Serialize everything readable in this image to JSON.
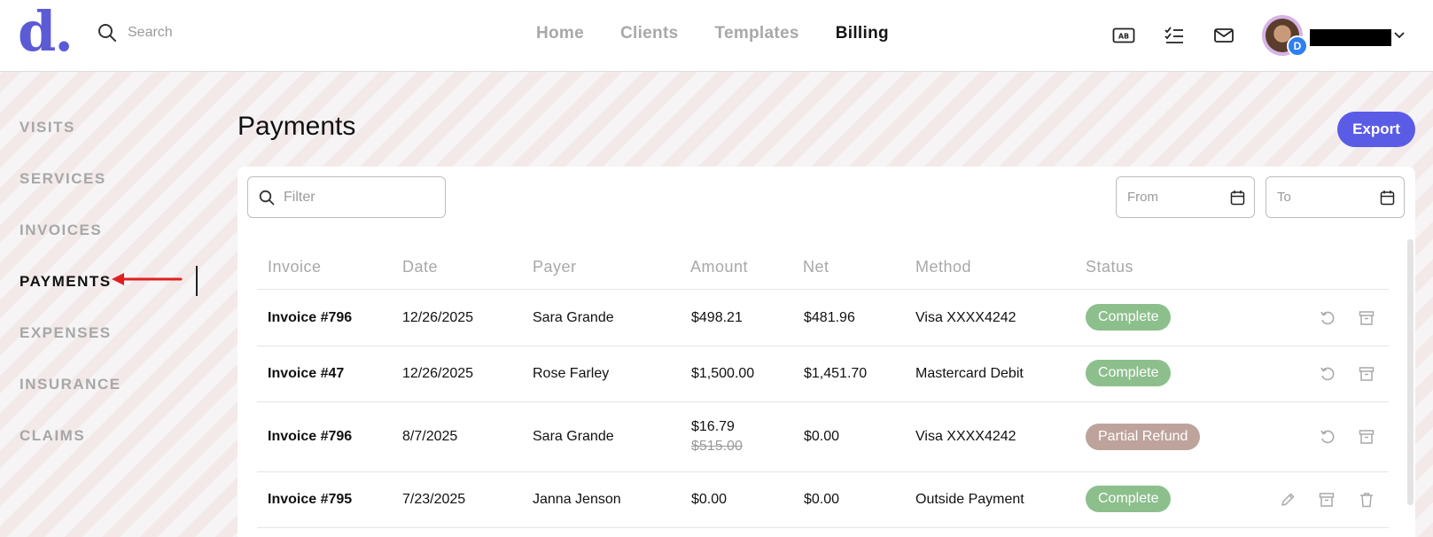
{
  "header": {
    "logo": "d.",
    "search_placeholder": "Search",
    "nav": [
      {
        "label": "Home",
        "active": false
      },
      {
        "label": "Clients",
        "active": false
      },
      {
        "label": "Templates",
        "active": false
      },
      {
        "label": "Billing",
        "active": true
      }
    ],
    "icons": [
      "language-icon",
      "checklist-icon",
      "mail-icon"
    ],
    "avatar_badge": "D"
  },
  "sidebar": {
    "items": [
      {
        "label": "VISITS",
        "active": false
      },
      {
        "label": "SERVICES",
        "active": false
      },
      {
        "label": "INVOICES",
        "active": false
      },
      {
        "label": "PAYMENTS",
        "active": true
      },
      {
        "label": "EXPENSES",
        "active": false
      },
      {
        "label": "INSURANCE",
        "active": false
      },
      {
        "label": "CLAIMS",
        "active": false
      }
    ]
  },
  "main": {
    "title": "Payments",
    "export_label": "Export",
    "filter_placeholder": "Filter",
    "from_placeholder": "From",
    "to_placeholder": "To"
  },
  "table": {
    "columns": [
      "Invoice",
      "Date",
      "Payer",
      "Amount",
      "Net",
      "Method",
      "Status"
    ],
    "rows": [
      {
        "invoice": "Invoice #796",
        "date": "12/26/2025",
        "payer": "Sara Grande",
        "amount": "$498.21",
        "amount_original": "",
        "net": "$481.96",
        "method": "Visa XXXX4242",
        "status": "Complete",
        "actions": [
          "refund-icon",
          "archive-icon"
        ]
      },
      {
        "invoice": "Invoice #47",
        "date": "12/26/2025",
        "payer": "Rose Farley",
        "amount": "$1,500.00",
        "amount_original": "",
        "net": "$1,451.70",
        "method": "Mastercard Debit",
        "status": "Complete",
        "actions": [
          "refund-icon",
          "archive-icon"
        ]
      },
      {
        "invoice": "Invoice #796",
        "date": "8/7/2025",
        "payer": "Sara Grande",
        "amount": "$16.79",
        "amount_original": "$515.00",
        "net": "$0.00",
        "method": "Visa XXXX4242",
        "status": "Partial Refund",
        "actions": [
          "refund-icon",
          "archive-icon"
        ]
      },
      {
        "invoice": "Invoice #795",
        "date": "7/23/2025",
        "payer": "Janna Jenson",
        "amount": "$0.00",
        "amount_original": "",
        "net": "$0.00",
        "method": "Outside Payment",
        "status": "Complete",
        "actions": [
          "edit-icon",
          "archive-icon",
          "trash-icon"
        ]
      }
    ]
  },
  "colors": {
    "accent": "#5b5ce6",
    "status_complete": "#8cbf8c",
    "status_partial_refund": "#bda39c"
  }
}
